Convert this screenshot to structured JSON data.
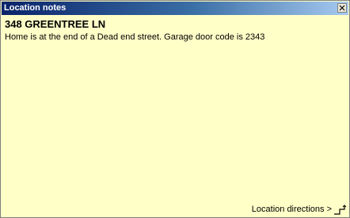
{
  "window": {
    "title": "Location notes",
    "close_glyph": "×"
  },
  "location": {
    "address": "348 GREENTREE LN",
    "notes": "Home is at the end of a Dead end street. Garage door code is 2343"
  },
  "footer": {
    "directions_label": "Location directions >",
    "directions_icon": "route-icon"
  },
  "colors": {
    "background": "#ffffc8",
    "titlebar_start": "#0a246a",
    "titlebar_end": "#a6caf0"
  }
}
